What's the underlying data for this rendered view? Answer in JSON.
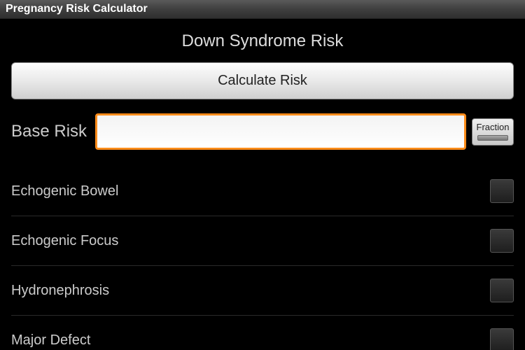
{
  "titlebar": {
    "app_name": "Pregnancy Risk Calculator"
  },
  "page": {
    "title": "Down Syndrome Risk"
  },
  "actions": {
    "calculate_label": "Calculate Risk"
  },
  "base_risk": {
    "label": "Base Risk",
    "value": "",
    "placeholder": ""
  },
  "fraction_toggle": {
    "label": "Fraction"
  },
  "findings": [
    {
      "label": "Echogenic Bowel"
    },
    {
      "label": "Echogenic Focus"
    },
    {
      "label": "Hydronephrosis"
    },
    {
      "label": "Major Defect"
    }
  ]
}
